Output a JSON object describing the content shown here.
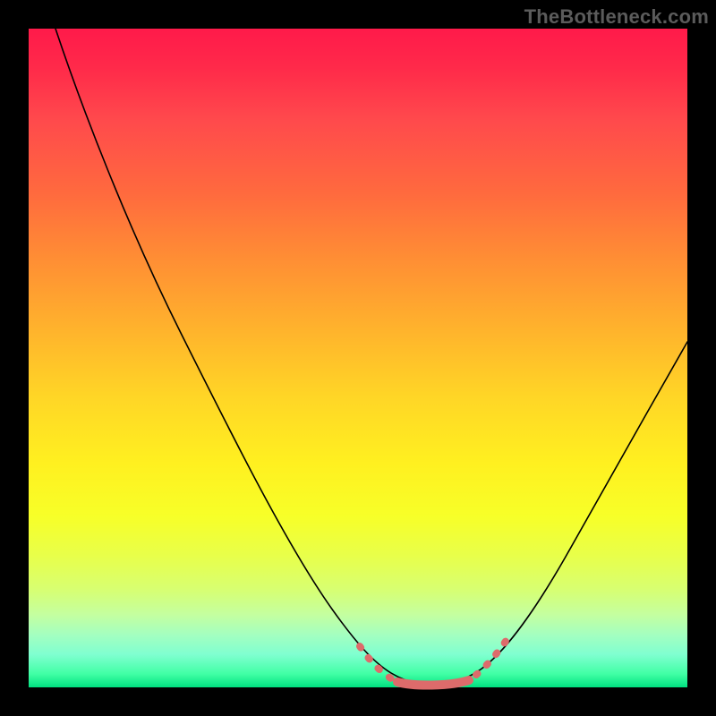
{
  "watermark": "TheBottleneck.com",
  "colors": {
    "background": "#000000",
    "curve": "#000000",
    "highlight": "#dd6b6b",
    "gradient_top": "#ff1a4a",
    "gradient_bottom": "#00e080"
  },
  "chart_data": {
    "type": "line",
    "title": "",
    "xlabel": "",
    "ylabel": "",
    "xlim": [
      0,
      100
    ],
    "ylim": [
      0,
      100
    ],
    "x": [
      0,
      5,
      10,
      15,
      20,
      25,
      30,
      35,
      40,
      45,
      48,
      50,
      52,
      55,
      58,
      60,
      62,
      65,
      70,
      75,
      80,
      85,
      90,
      95,
      100
    ],
    "values": [
      100,
      92,
      82,
      72,
      62,
      52,
      42,
      33,
      24,
      15,
      9,
      5,
      2.5,
      1,
      0.4,
      0.2,
      0.4,
      1.2,
      4,
      10,
      18,
      27,
      36,
      45,
      54
    ],
    "notes": "V-shaped bottleneck curve over rainbow heat gradient; minimum around x≈60; red dashed highlights mark the flat optimal region near the bottom."
  }
}
